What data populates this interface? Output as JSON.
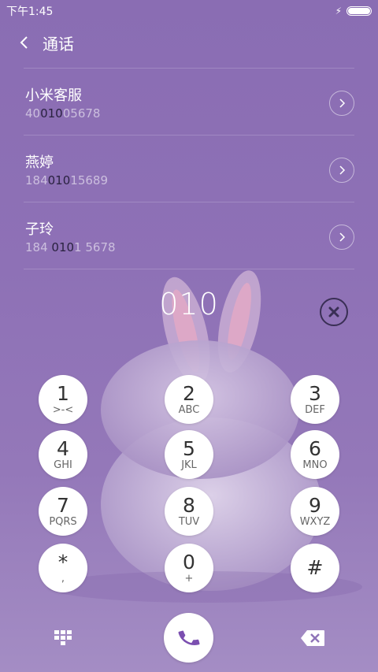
{
  "status_bar": {
    "time": "下午1:45"
  },
  "header": {
    "title": "通话"
  },
  "contacts": [
    {
      "name": "小米客服",
      "number_pre": "40",
      "number_hl": "010",
      "number_post": "05678"
    },
    {
      "name": "燕婷",
      "number_pre": "184",
      "number_hl": "010",
      "number_post": "15689"
    },
    {
      "name": "子玲",
      "number_pre": "184 ",
      "number_hl": "010",
      "number_post": "1 5678"
    }
  ],
  "dialer": {
    "input": "010"
  },
  "keys": [
    {
      "digit": "1",
      "letters": ">-<"
    },
    {
      "digit": "2",
      "letters": "ABC"
    },
    {
      "digit": "3",
      "letters": "DEF"
    },
    {
      "digit": "4",
      "letters": "GHI"
    },
    {
      "digit": "5",
      "letters": "JKL"
    },
    {
      "digit": "6",
      "letters": "MNO"
    },
    {
      "digit": "7",
      "letters": "PQRS"
    },
    {
      "digit": "8",
      "letters": "TUV"
    },
    {
      "digit": "9",
      "letters": "WXYZ"
    },
    {
      "digit": "*",
      "letters": ","
    },
    {
      "digit": "0",
      "letters": "+"
    },
    {
      "digit": "#",
      "letters": ""
    }
  ],
  "icons": {
    "back": "back-arrow-icon",
    "detail": "chevron-right-icon",
    "clear": "clear-x-icon",
    "keypad_toggle": "dialpad-icon",
    "call": "phone-icon",
    "backspace": "backspace-icon"
  },
  "colors": {
    "accent": "#7b4fb0",
    "background": "#8a6db3",
    "highlight_text": "#2a2240"
  }
}
